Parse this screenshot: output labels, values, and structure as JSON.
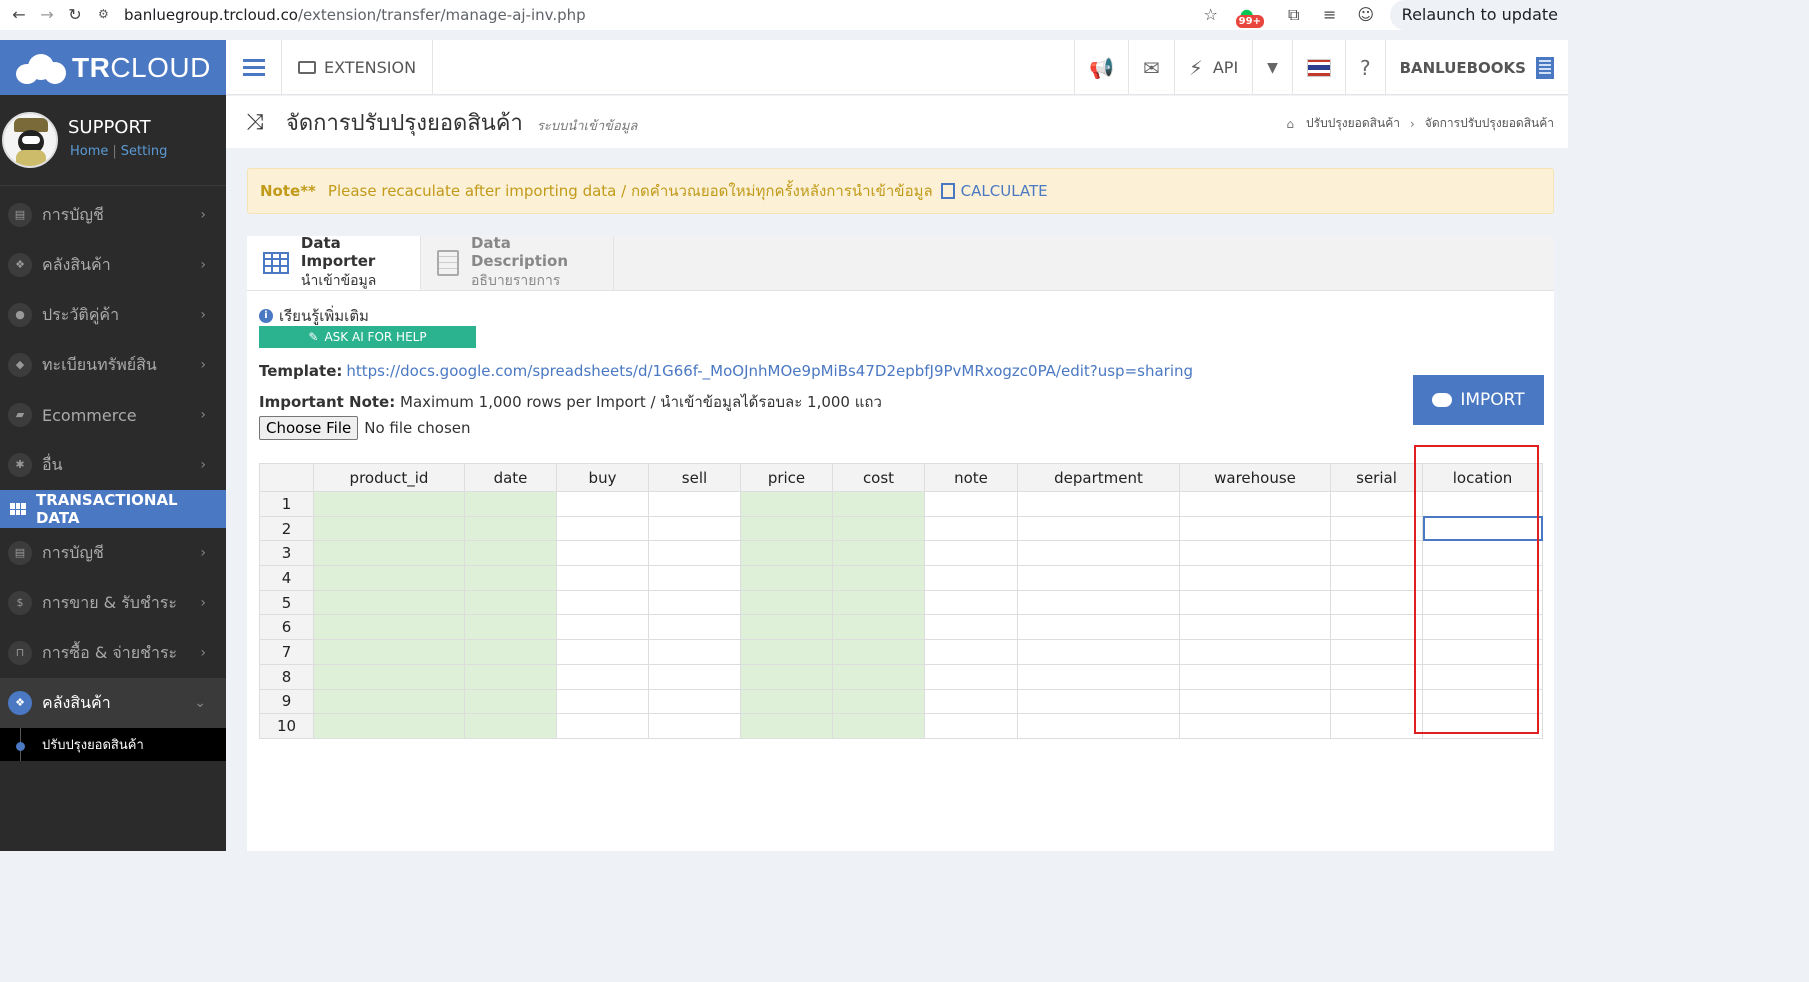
{
  "browser": {
    "url_host": "banluegroup.trcloud.co",
    "url_path": "/extension/transfer/manage-aj-inv.php",
    "badge": "99+",
    "relaunch": "Relaunch to update"
  },
  "brand": {
    "logo_bold": "TR",
    "logo_rest": "CLOUD"
  },
  "profile": {
    "name": "SUPPORT",
    "home_link": "Home",
    "setting_link": "Setting"
  },
  "sidebar": {
    "master_items": [
      {
        "label": "การบัญชี",
        "icon": "book-icon"
      },
      {
        "label": "คลังสินค้า",
        "icon": "cubes-icon"
      },
      {
        "label": "ประวัติคู่ค้า",
        "icon": "user-icon"
      },
      {
        "label": "ทะเบียนทรัพย์สิน",
        "icon": "diamond-icon"
      },
      {
        "label": "Ecommerce",
        "icon": "bag-icon"
      },
      {
        "label": "อื่น",
        "icon": "gear-icon"
      }
    ],
    "section_title": "TRANSACTIONAL DATA",
    "trans_items": [
      {
        "label": "การบัญชี",
        "icon": "book-icon"
      },
      {
        "label": "การขาย & รับชำระ",
        "icon": "dollar-icon"
      },
      {
        "label": "การซื้อ & จ่ายชำระ",
        "icon": "cart-icon"
      }
    ],
    "active_item": "คลังสินค้า",
    "active_sub": "ปรับปรุงยอดสินค้า"
  },
  "topbar": {
    "extension": "EXTENSION",
    "api": "API",
    "company": "BANLUEBOOKS"
  },
  "page": {
    "title": "จัดการปรับปรุงยอดสินค้า",
    "subtitle": "ระบบนำเข้าข้อมูล",
    "breadcrumb_parent": "ปรับปรุงยอดสินค้า",
    "breadcrumb_current": "จัดการปรับปรุงยอดสินค้า"
  },
  "alert": {
    "label": "Note**",
    "text": "Please recaculate after importing data / กดคำนวณยอดใหม่ทุกครั้งหลังการนำเข้าข้อมูล",
    "action": "CALCULATE"
  },
  "tabs": [
    {
      "title": "Data Importer",
      "sub": "นำเข้าข้อมูล"
    },
    {
      "title": "Data Description",
      "sub": "อธิบายรายการ"
    }
  ],
  "importer": {
    "learn_more": "เรียนรู้เพิ่มเติม",
    "ai_button": "ASK AI FOR HELP",
    "template_label": "Template:",
    "template_url": "https://docs.google.com/spreadsheets/d/1G66f-_MoOJnhMOe9pMiBs47D2epbfJ9PvMRxogzc0PA/edit?usp=sharing",
    "note_label": "Important Note:",
    "note_text": "Maximum 1,000 rows per Import / นำเข้าข้อมูลได้รอบละ 1,000 แถว",
    "choose_file": "Choose File",
    "no_file": "No file chosen",
    "import_button": "IMPORT"
  },
  "grid": {
    "columns": [
      "product_id",
      "date",
      "buy",
      "sell",
      "price",
      "cost",
      "note",
      "department",
      "warehouse",
      "serial",
      "location"
    ],
    "rows": [
      "1",
      "2",
      "3",
      "4",
      "5",
      "6",
      "7",
      "8",
      "9",
      "10"
    ],
    "required_columns": [
      "product_id",
      "date",
      "price",
      "cost"
    ],
    "selected_cell": {
      "row": "2",
      "column": "location"
    },
    "colors": {
      "required": "#dff0d8",
      "header": "#f3f3f3",
      "highlight_box": "#e02020",
      "accent": "#4a78c2"
    }
  }
}
